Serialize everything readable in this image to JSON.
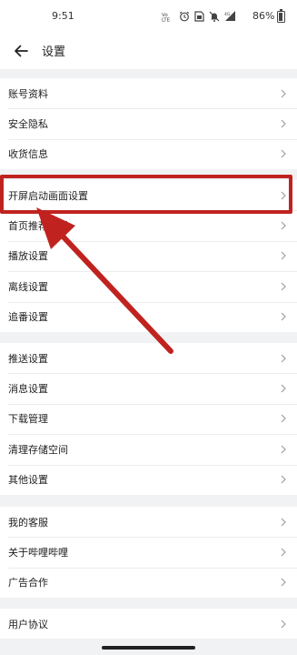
{
  "status_bar": {
    "time": "9:51",
    "battery": "86%",
    "icons": [
      "hd-voice-icon",
      "alarm-icon",
      "sim-icon",
      "dnd-icon",
      "signal-icon"
    ]
  },
  "header": {
    "title": "设置"
  },
  "groups": [
    {
      "items": [
        "账号资料",
        "安全隐私",
        "收货信息"
      ]
    },
    {
      "items": [
        "开屏启动画面设置",
        "首页推荐设置",
        "播放设置",
        "离线设置",
        "追番设置"
      ]
    },
    {
      "items": [
        "推送设置",
        "消息设置",
        "下载管理",
        "清理存储空间",
        "其他设置"
      ]
    },
    {
      "items": [
        "我的客服",
        "关于哔哩哔哩",
        "广告合作"
      ]
    },
    {
      "items": [
        "用户协议"
      ]
    }
  ],
  "annotation": {
    "highlight_color": "#c0231f",
    "target_item": "开屏启动画面设置"
  },
  "colors": {
    "background": "#f1f2f3",
    "surface": "#ffffff",
    "text": "#212121",
    "chevron": "#9e9e9e"
  }
}
